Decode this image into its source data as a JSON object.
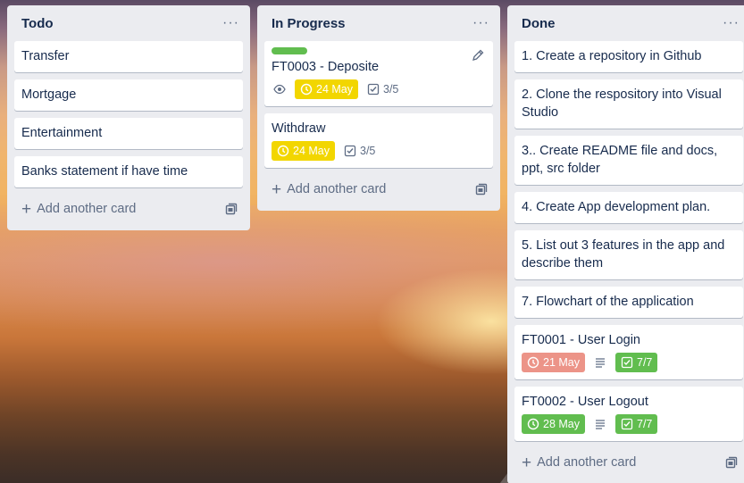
{
  "board": {
    "colors": {
      "list_bg": "#ebecf0",
      "green": "#61bd4f",
      "yellow": "#f2d600",
      "red_soft": "#ec9488"
    }
  },
  "lists": [
    {
      "title": "Todo",
      "menu": "···",
      "cards": [
        {
          "title": "Transfer"
        },
        {
          "title": "Mortgage"
        },
        {
          "title": "Entertainment"
        },
        {
          "title": "Banks statement if have time"
        }
      ],
      "add_card": "Add another card"
    },
    {
      "title": "In Progress",
      "menu": "···",
      "cards": [
        {
          "title": "FT0003 - Deposite",
          "label_color": "green",
          "due": "24 May",
          "due_status": "due-soon",
          "checklist": "3/5",
          "watching": true
        },
        {
          "title": "Withdraw",
          "due": "24 May",
          "due_status": "due-soon",
          "checklist": "3/5"
        }
      ],
      "add_card": "Add another card"
    },
    {
      "title": "Done",
      "menu": "···",
      "cards": [
        {
          "title": "1. Create a repository in Github"
        },
        {
          "title": "2. Clone the respository into Visual Studio"
        },
        {
          "title": "3.. Create README file and docs, ppt, src folder"
        },
        {
          "title": "4. Create App development plan."
        },
        {
          "title": "5. List out 3 features in the app and describe them"
        },
        {
          "title": "7. Flowchart of the application"
        },
        {
          "title": "FT0001 - User Login",
          "due": "21 May",
          "due_status": "overdue",
          "has_description": true,
          "checklist": "7/7",
          "checklist_complete": true
        },
        {
          "title": "FT0002 - User Logout",
          "due": "28 May",
          "due_status": "complete",
          "has_description": true,
          "checklist": "7/7",
          "checklist_complete": true
        }
      ],
      "add_card": "Add another card"
    }
  ]
}
